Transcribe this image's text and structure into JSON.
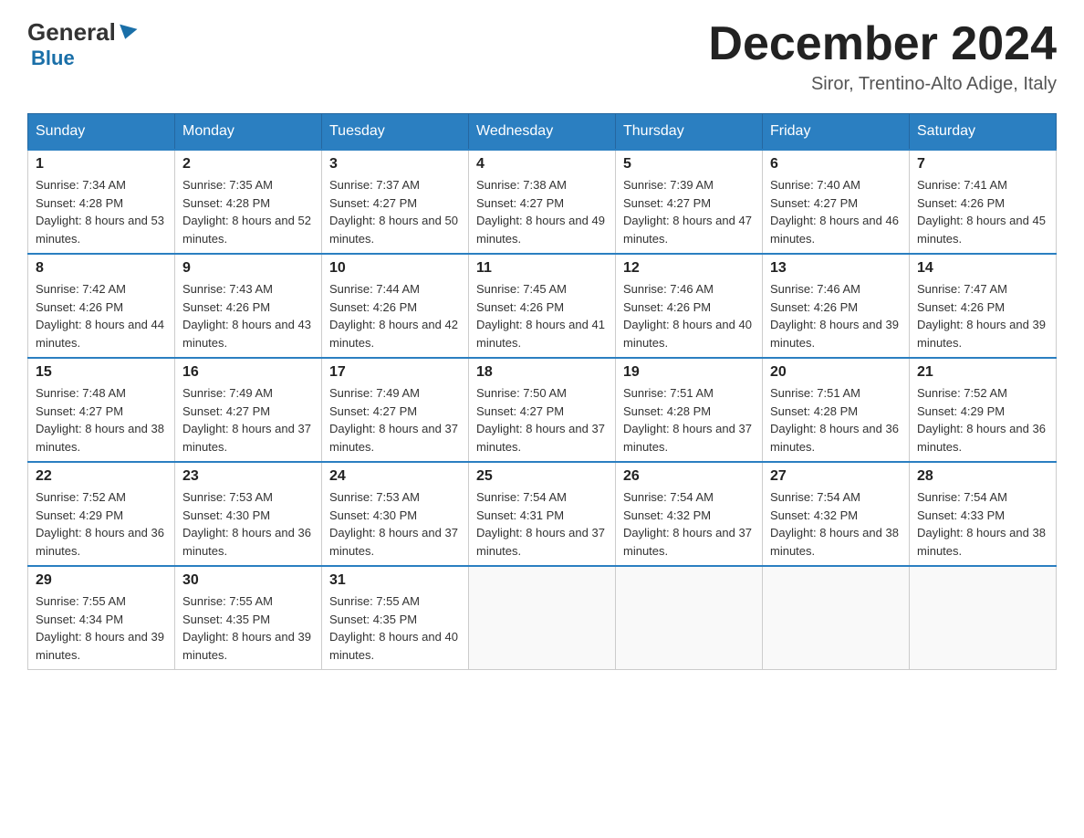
{
  "header": {
    "logo": {
      "general": "General",
      "blue": "Blue"
    },
    "title": "December 2024",
    "subtitle": "Siror, Trentino-Alto Adige, Italy"
  },
  "days_of_week": [
    "Sunday",
    "Monday",
    "Tuesday",
    "Wednesday",
    "Thursday",
    "Friday",
    "Saturday"
  ],
  "weeks": [
    [
      {
        "day": "1",
        "sunrise": "7:34 AM",
        "sunset": "4:28 PM",
        "daylight": "8 hours and 53 minutes."
      },
      {
        "day": "2",
        "sunrise": "7:35 AM",
        "sunset": "4:28 PM",
        "daylight": "8 hours and 52 minutes."
      },
      {
        "day": "3",
        "sunrise": "7:37 AM",
        "sunset": "4:27 PM",
        "daylight": "8 hours and 50 minutes."
      },
      {
        "day": "4",
        "sunrise": "7:38 AM",
        "sunset": "4:27 PM",
        "daylight": "8 hours and 49 minutes."
      },
      {
        "day": "5",
        "sunrise": "7:39 AM",
        "sunset": "4:27 PM",
        "daylight": "8 hours and 47 minutes."
      },
      {
        "day": "6",
        "sunrise": "7:40 AM",
        "sunset": "4:27 PM",
        "daylight": "8 hours and 46 minutes."
      },
      {
        "day": "7",
        "sunrise": "7:41 AM",
        "sunset": "4:26 PM",
        "daylight": "8 hours and 45 minutes."
      }
    ],
    [
      {
        "day": "8",
        "sunrise": "7:42 AM",
        "sunset": "4:26 PM",
        "daylight": "8 hours and 44 minutes."
      },
      {
        "day": "9",
        "sunrise": "7:43 AM",
        "sunset": "4:26 PM",
        "daylight": "8 hours and 43 minutes."
      },
      {
        "day": "10",
        "sunrise": "7:44 AM",
        "sunset": "4:26 PM",
        "daylight": "8 hours and 42 minutes."
      },
      {
        "day": "11",
        "sunrise": "7:45 AM",
        "sunset": "4:26 PM",
        "daylight": "8 hours and 41 minutes."
      },
      {
        "day": "12",
        "sunrise": "7:46 AM",
        "sunset": "4:26 PM",
        "daylight": "8 hours and 40 minutes."
      },
      {
        "day": "13",
        "sunrise": "7:46 AM",
        "sunset": "4:26 PM",
        "daylight": "8 hours and 39 minutes."
      },
      {
        "day": "14",
        "sunrise": "7:47 AM",
        "sunset": "4:26 PM",
        "daylight": "8 hours and 39 minutes."
      }
    ],
    [
      {
        "day": "15",
        "sunrise": "7:48 AM",
        "sunset": "4:27 PM",
        "daylight": "8 hours and 38 minutes."
      },
      {
        "day": "16",
        "sunrise": "7:49 AM",
        "sunset": "4:27 PM",
        "daylight": "8 hours and 37 minutes."
      },
      {
        "day": "17",
        "sunrise": "7:49 AM",
        "sunset": "4:27 PM",
        "daylight": "8 hours and 37 minutes."
      },
      {
        "day": "18",
        "sunrise": "7:50 AM",
        "sunset": "4:27 PM",
        "daylight": "8 hours and 37 minutes."
      },
      {
        "day": "19",
        "sunrise": "7:51 AM",
        "sunset": "4:28 PM",
        "daylight": "8 hours and 37 minutes."
      },
      {
        "day": "20",
        "sunrise": "7:51 AM",
        "sunset": "4:28 PM",
        "daylight": "8 hours and 36 minutes."
      },
      {
        "day": "21",
        "sunrise": "7:52 AM",
        "sunset": "4:29 PM",
        "daylight": "8 hours and 36 minutes."
      }
    ],
    [
      {
        "day": "22",
        "sunrise": "7:52 AM",
        "sunset": "4:29 PM",
        "daylight": "8 hours and 36 minutes."
      },
      {
        "day": "23",
        "sunrise": "7:53 AM",
        "sunset": "4:30 PM",
        "daylight": "8 hours and 36 minutes."
      },
      {
        "day": "24",
        "sunrise": "7:53 AM",
        "sunset": "4:30 PM",
        "daylight": "8 hours and 37 minutes."
      },
      {
        "day": "25",
        "sunrise": "7:54 AM",
        "sunset": "4:31 PM",
        "daylight": "8 hours and 37 minutes."
      },
      {
        "day": "26",
        "sunrise": "7:54 AM",
        "sunset": "4:32 PM",
        "daylight": "8 hours and 37 minutes."
      },
      {
        "day": "27",
        "sunrise": "7:54 AM",
        "sunset": "4:32 PM",
        "daylight": "8 hours and 38 minutes."
      },
      {
        "day": "28",
        "sunrise": "7:54 AM",
        "sunset": "4:33 PM",
        "daylight": "8 hours and 38 minutes."
      }
    ],
    [
      {
        "day": "29",
        "sunrise": "7:55 AM",
        "sunset": "4:34 PM",
        "daylight": "8 hours and 39 minutes."
      },
      {
        "day": "30",
        "sunrise": "7:55 AM",
        "sunset": "4:35 PM",
        "daylight": "8 hours and 39 minutes."
      },
      {
        "day": "31",
        "sunrise": "7:55 AM",
        "sunset": "4:35 PM",
        "daylight": "8 hours and 40 minutes."
      },
      null,
      null,
      null,
      null
    ]
  ]
}
